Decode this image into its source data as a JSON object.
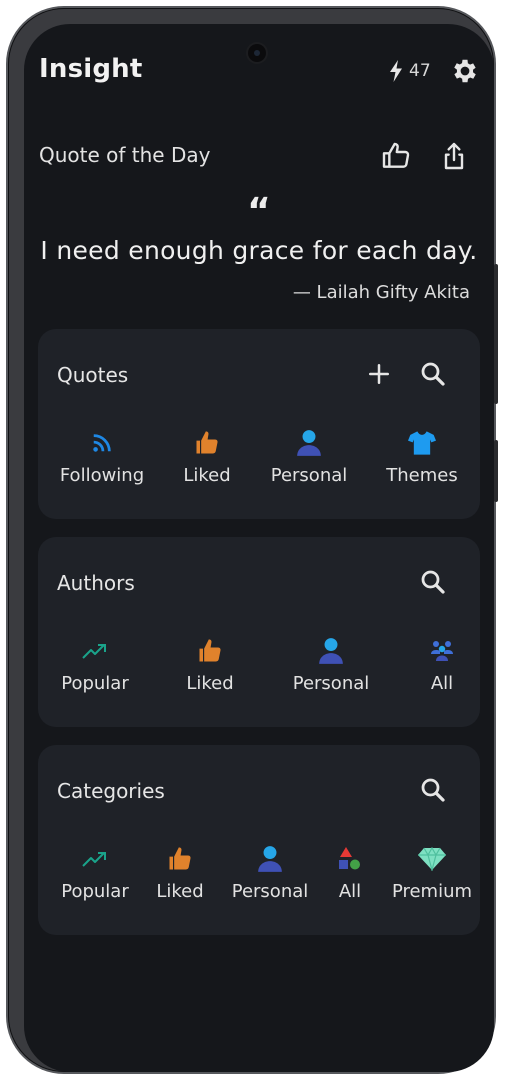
{
  "header": {
    "app_title": "Insight",
    "energy_count": "47"
  },
  "quote_of_the_day": {
    "label": "Quote of the Day",
    "quote_mark": "“",
    "text": "I need enough grace for each day.",
    "author": "— Lailah Gifty Akita"
  },
  "quotes_card": {
    "title": "Quotes",
    "items": [
      {
        "label": "Following",
        "icon": "rss-icon"
      },
      {
        "label": "Liked",
        "icon": "thumbs-up-icon"
      },
      {
        "label": "Personal",
        "icon": "person-icon"
      },
      {
        "label": "Themes",
        "icon": "tshirt-icon"
      }
    ]
  },
  "authors_card": {
    "title": "Authors",
    "items": [
      {
        "label": "Popular",
        "icon": "trending-icon"
      },
      {
        "label": "Liked",
        "icon": "thumbs-up-icon"
      },
      {
        "label": "Personal",
        "icon": "person-icon"
      },
      {
        "label": "All",
        "icon": "group-icon"
      }
    ]
  },
  "categories_card": {
    "title": "Categories",
    "items": [
      {
        "label": "Popular",
        "icon": "trending-icon"
      },
      {
        "label": "Liked",
        "icon": "thumbs-up-icon"
      },
      {
        "label": "Personal",
        "icon": "person-icon"
      },
      {
        "label": "All",
        "icon": "shapes-icon"
      },
      {
        "label": "Premium",
        "icon": "diamond-icon"
      }
    ]
  },
  "colors": {
    "background": "#15171b",
    "card": "#1f2228",
    "rss_blue": "#1e88e5",
    "thumb_orange": "#e0822c",
    "person_top": "#26a6e8",
    "person_body": "#3f51b5",
    "trending_green": "#1aa38a",
    "diamond_green": "#7ee0c2"
  }
}
